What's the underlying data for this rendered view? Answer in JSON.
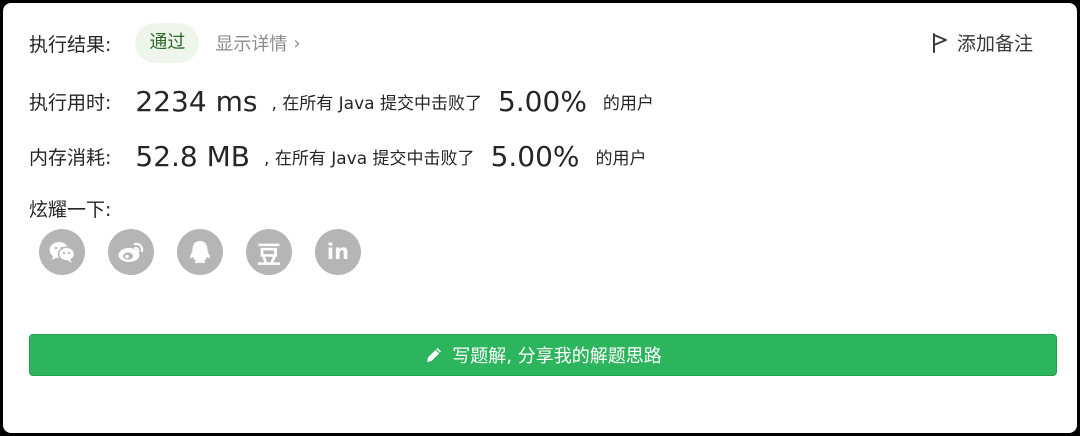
{
  "result": {
    "label": "执行结果:",
    "status": "通过",
    "detail_link": "显示详情",
    "add_note": "添加备注"
  },
  "runtime": {
    "label": "执行用时:",
    "value": "2234 ms",
    "beat_text": ", 在所有 Java 提交中击败了",
    "percent": "5.00%",
    "users_text": "的用户"
  },
  "memory": {
    "label": "内存消耗:",
    "value": "52.8 MB",
    "beat_text": ", 在所有 Java 提交中击败了",
    "percent": "5.00%",
    "users_text": "的用户"
  },
  "share": {
    "label": "炫耀一下:",
    "icons": [
      "wechat-icon",
      "weibo-icon",
      "qq-icon",
      "douban-icon",
      "linkedin-icon"
    ],
    "douban_glyph": "豆",
    "linkedin_glyph": "in"
  },
  "write_solution": {
    "label": "写题解, 分享我的解题思路"
  },
  "colors": {
    "accent_green": "#2db55d",
    "badge_bg": "#eef6ec",
    "icon_gray": "#b5b5b5"
  }
}
